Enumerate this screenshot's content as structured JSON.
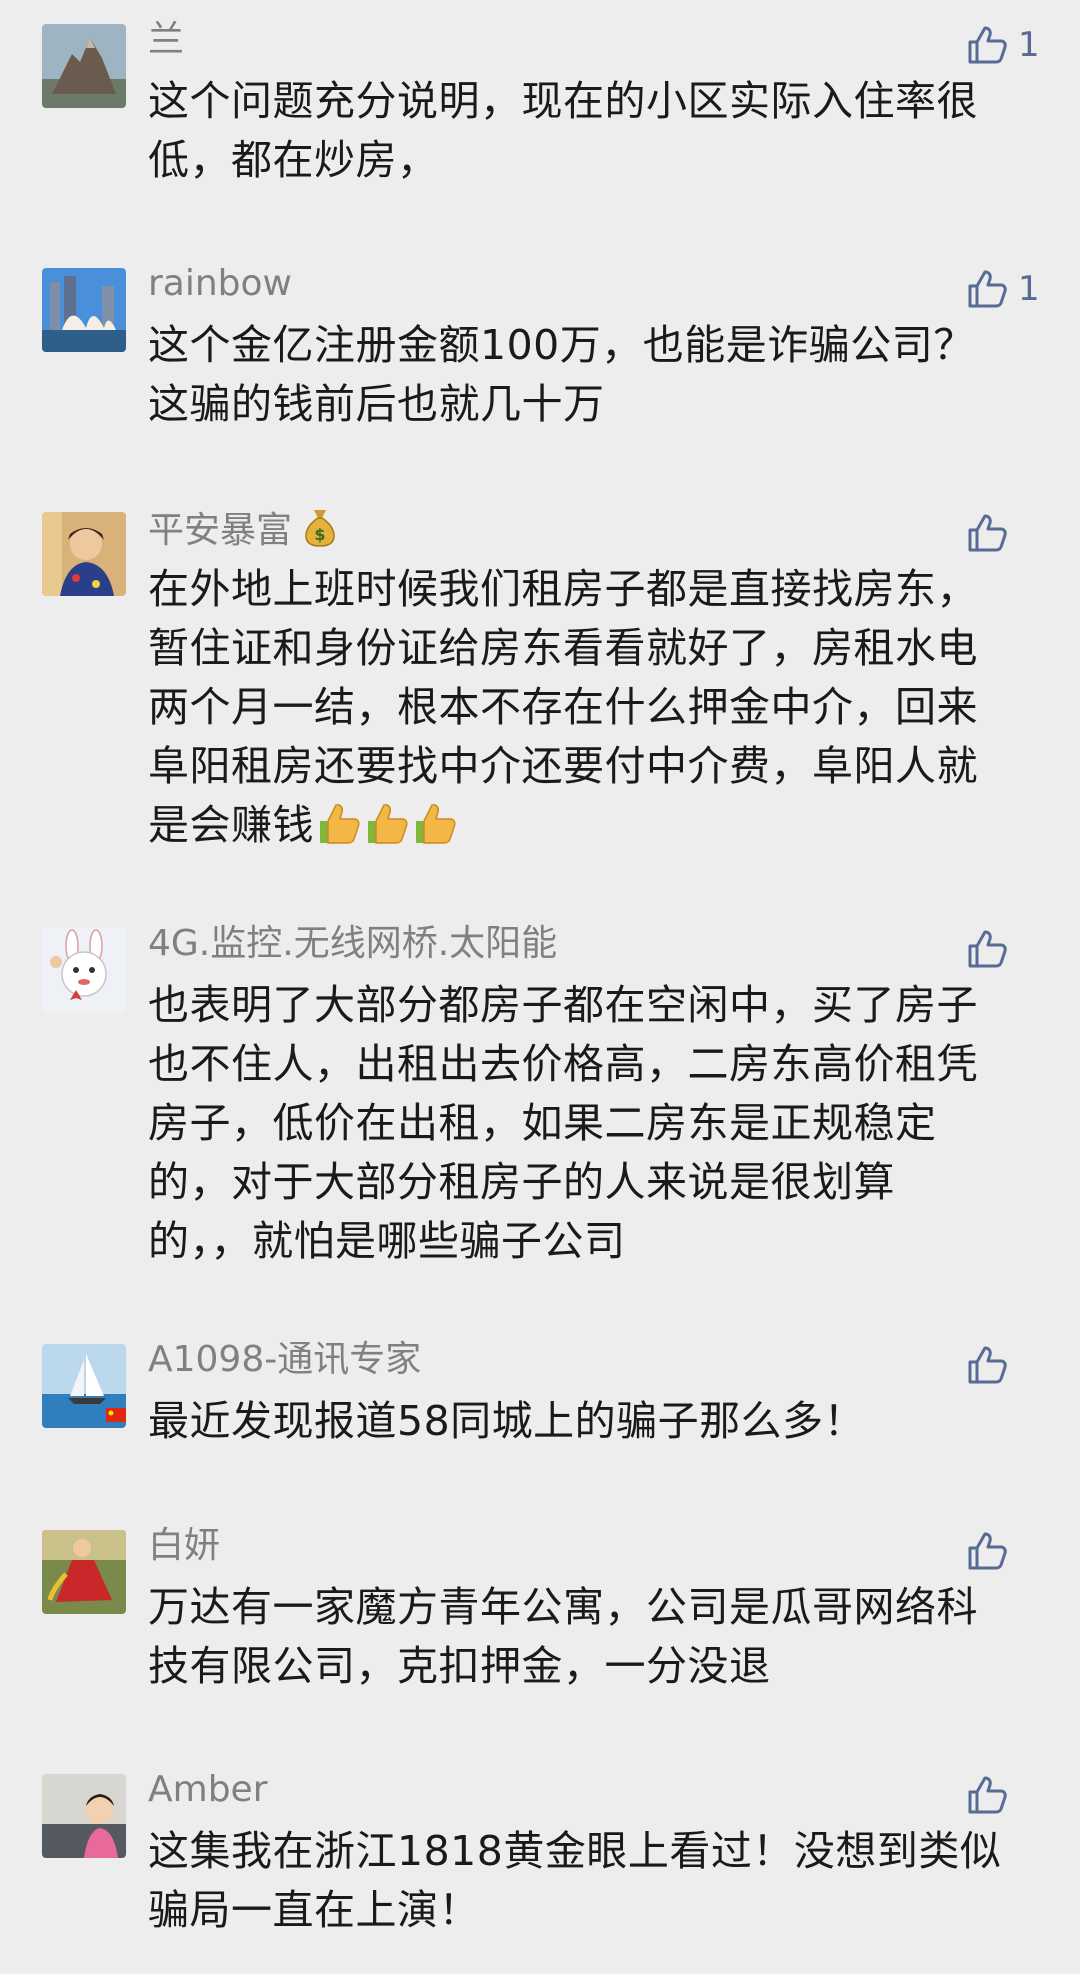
{
  "comments": [
    {
      "nickname": "兰",
      "lines": [
        "这个问题充分说明，现在的小区实际入住率很",
        "低，都在炒房，"
      ],
      "likes": "1",
      "avatar": "mountain-avatar-icon"
    },
    {
      "nickname": "rainbow",
      "lines": [
        "这个金亿注册金额100万，也能是诈骗公司？",
        "这骗的钱前后也就几十万"
      ],
      "likes": "1",
      "avatar": "sydney-opera-house-avatar-icon"
    },
    {
      "nickname": "平安暴富",
      "nickname_emoji": "money-bag-icon",
      "lines": [
        "在外地上班时候我们租房子都是直接找房东，",
        "暂住证和身份证给房东看看就好了，房租水电",
        "两个月一结，根本不存在什么押金中介，回来",
        "阜阳租房还要找中介还要付中介费，阜阳人就",
        "是会赚钱"
      ],
      "trailing_emoji": "thumbs-up-emoji-icon",
      "trailing_emoji_count": 3,
      "likes": "",
      "avatar": "portrait-avatar-icon"
    },
    {
      "nickname": "4G.监控.无线网桥.太阳能",
      "lines": [
        "也表明了大部分都房子都在空闲中，买了房子",
        "也不住人，出租出去价格高，二房东高价租凭",
        "房子，低价在出租，如果二房东是正规稳定",
        "的，对于大部分租房子的人来说是很划算",
        "的，，就怕是哪些骗子公司"
      ],
      "likes": "",
      "avatar": "rabbit-avatar-icon"
    },
    {
      "nickname": "A1098-通讯专家",
      "lines": [
        "最近发现报道58同城上的骗子那么多！"
      ],
      "likes": "",
      "avatar": "sailboat-avatar-icon"
    },
    {
      "nickname": "白妍",
      "lines": [
        "万达有一家魔方青年公寓，公司是瓜哥网络科",
        "技有限公司，克扣押金，一分没退"
      ],
      "likes": "",
      "avatar": "red-dress-avatar-icon"
    },
    {
      "nickname": "Amber",
      "lines": [
        "这集我在浙江1818黄金眼上看过！没想到类似",
        "骗局一直在上演！"
      ],
      "likes": "",
      "avatar": "child-avatar-icon"
    }
  ],
  "colors": {
    "background": "#ededed",
    "nickname": "#808080",
    "content": "#1a1a1a",
    "like_icon": "#576b95"
  }
}
